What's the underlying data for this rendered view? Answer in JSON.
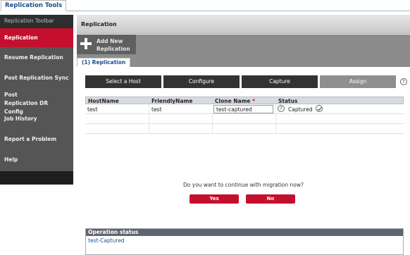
{
  "app": {
    "tab_title": "Replication Tools"
  },
  "sidebar": {
    "header": "Replication Toolbar",
    "items": [
      {
        "label": "Replication",
        "active": true
      },
      {
        "label": "Resume Replication"
      },
      {
        "label": "Post Replication Sync"
      },
      {
        "label": "Post Replication DR Config"
      },
      {
        "label": "Job History"
      },
      {
        "label": "Report a Problem"
      },
      {
        "label": "Help"
      }
    ]
  },
  "main": {
    "title": "Replication",
    "add_button": {
      "line1": "Add New",
      "line2": "Replication"
    },
    "subtab": "(1) Replication",
    "steps": [
      {
        "label": "Select a Host"
      },
      {
        "label": "Configure"
      },
      {
        "label": "Capture"
      },
      {
        "label": "Assign",
        "active": true
      }
    ],
    "table": {
      "columns": [
        "HostName",
        "FriendlyName",
        "Clone Name",
        "Status"
      ],
      "required_marker": "*",
      "row": {
        "hostname": "test",
        "friendlyname": "test",
        "clone_name": "test-captured",
        "status": "Captured"
      }
    },
    "question": "Do you want to continue with migration now?",
    "yes_label": "Yes",
    "no_label": "No",
    "operation_status": {
      "title": "Operation status",
      "text": "test-Captured"
    }
  },
  "colors": {
    "accent": "#c4102e",
    "sidebar_bg": "#555555",
    "link": "#1a4f8a"
  },
  "icons": [
    "plus-icon",
    "help-icon",
    "check-icon"
  ]
}
